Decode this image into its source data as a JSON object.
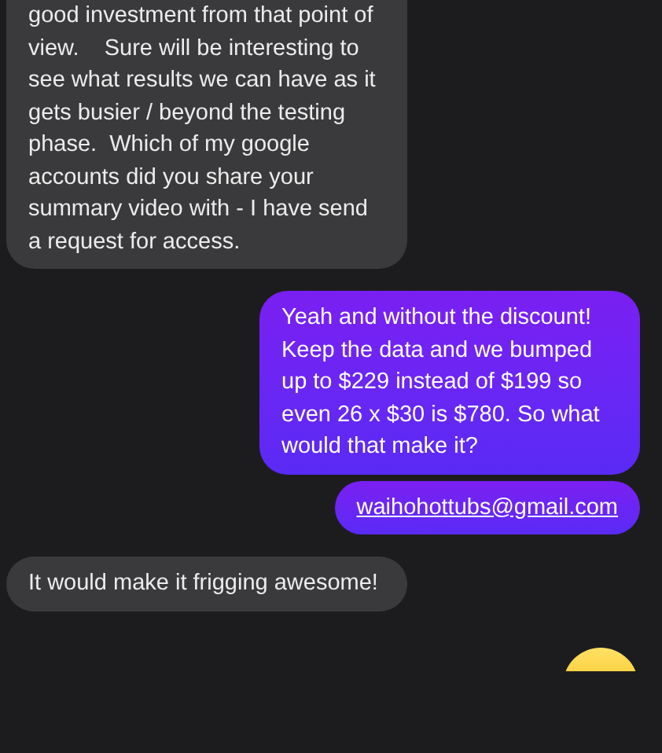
{
  "messages": [
    {
      "outgoing": false,
      "kind": "text",
      "text": "good investment from that point of view.    Sure will be interesting to see what results we can have as it gets busier / beyond the testing phase.  Which of my google accounts did you share your summary video with - I have send a request for access.",
      "cut_top": true
    },
    {
      "outgoing": true,
      "kind": "text",
      "text": "Yeah and without the discount! Keep the data and we bumped up to $229 instead of $199 so even 26 x $30 is $780. So what would that make it?"
    },
    {
      "outgoing": true,
      "kind": "link",
      "text": "waihohottubs@gmail.com"
    },
    {
      "outgoing": false,
      "kind": "text",
      "text": "It would make it frigging awesome!"
    },
    {
      "outgoing": true,
      "kind": "emoji"
    }
  ]
}
